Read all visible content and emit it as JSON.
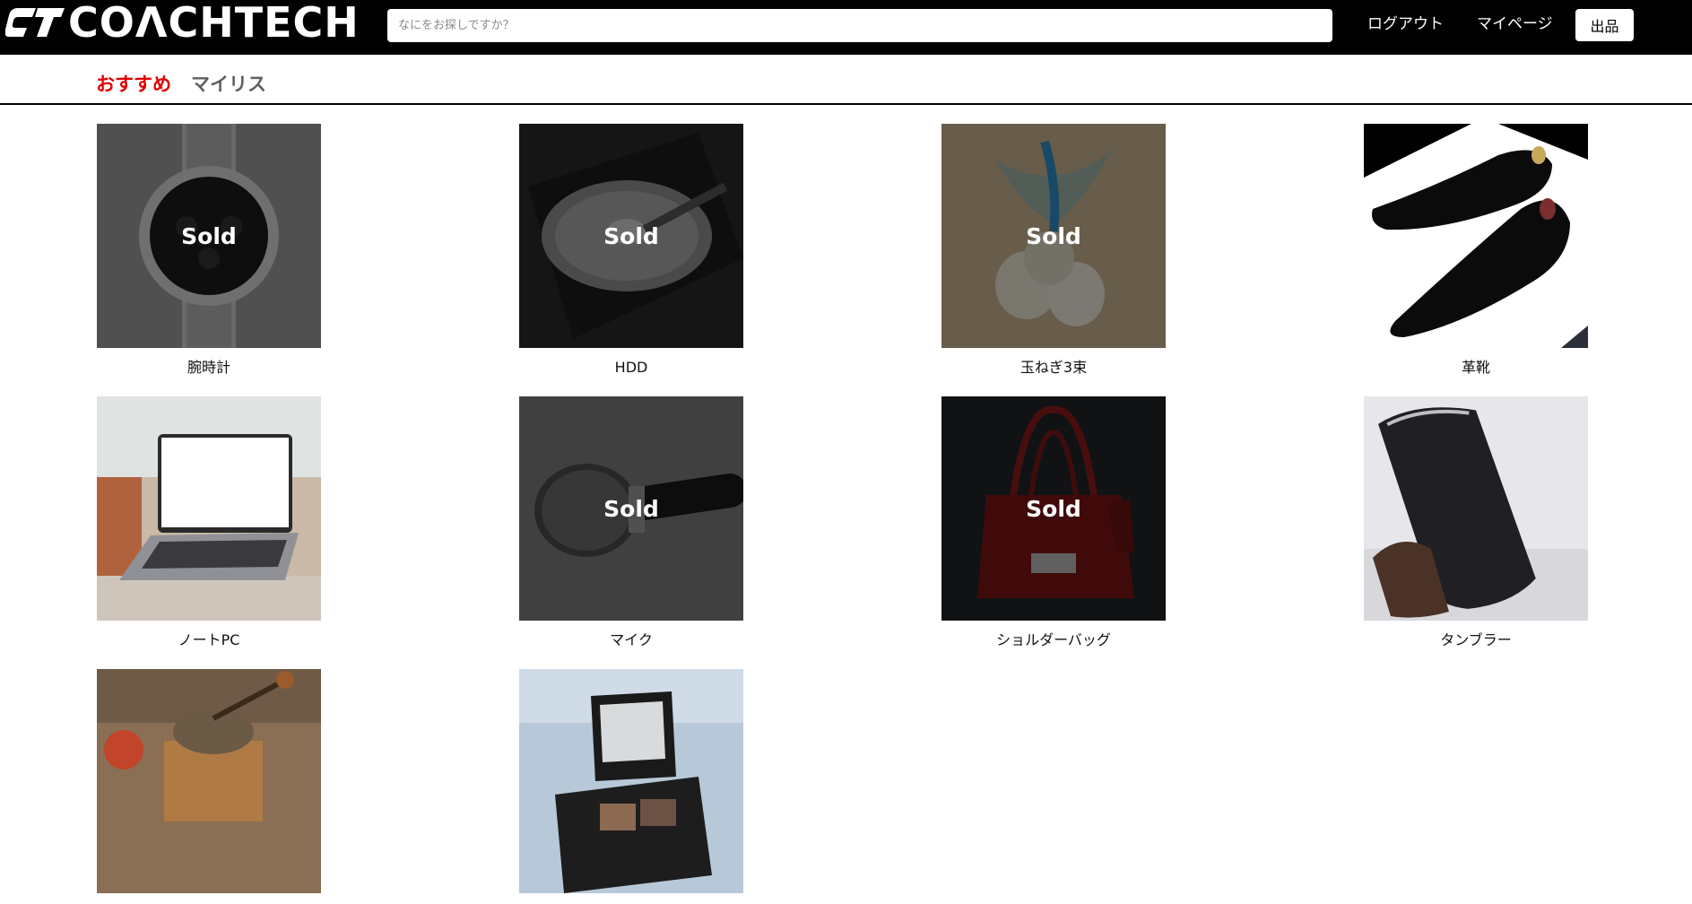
{
  "header": {
    "brand": "COΛCHTECH",
    "search_placeholder": "なにをお探しですか？",
    "logout_label": "ログアウト",
    "mypage_label": "マイページ",
    "sell_label": "出品"
  },
  "tabs": {
    "recommended": "おすすめ",
    "mylist": "マイリス"
  },
  "colors": {
    "accent": "#e00000",
    "header_bg": "#000000"
  },
  "sold_label": "Sold",
  "items": [
    {
      "name": "腕時計",
      "sold": true
    },
    {
      "name": "HDD",
      "sold": true
    },
    {
      "name": "玉ねぎ3束",
      "sold": true
    },
    {
      "name": "革靴",
      "sold": false
    },
    {
      "name": "ノートPC",
      "sold": false
    },
    {
      "name": "マイク",
      "sold": true
    },
    {
      "name": "ショルダーバッグ",
      "sold": true
    },
    {
      "name": "タンブラー",
      "sold": false
    },
    {
      "name": "",
      "sold": false
    },
    {
      "name": "",
      "sold": false
    }
  ]
}
